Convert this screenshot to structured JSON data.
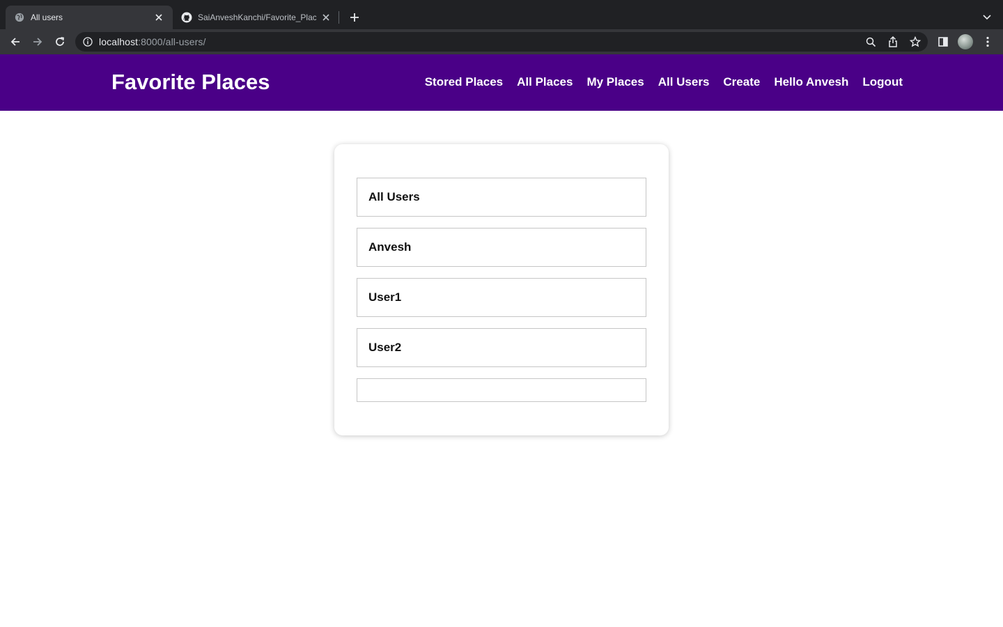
{
  "browser": {
    "tabs": [
      {
        "title": "All users",
        "active": true,
        "icon": "globe-icon"
      },
      {
        "title": "SaiAnveshKanchi/Favorite_Places",
        "active": false,
        "icon": "github-icon"
      }
    ],
    "url": {
      "host": "localhost",
      "rest": ":8000/all-users/"
    }
  },
  "header": {
    "brand": "Favorite Places",
    "nav": [
      "Stored Places",
      "All Places",
      "My Places",
      "All Users",
      "Create",
      "Hello Anvesh",
      "Logout"
    ]
  },
  "main": {
    "heading": "All Users",
    "users": [
      "Anvesh",
      "User1",
      "User2"
    ],
    "trailing_row": ""
  },
  "colors": {
    "header_bg": "#4a0087",
    "chrome_dark": "#202124",
    "chrome_toolbar": "#35363a"
  }
}
